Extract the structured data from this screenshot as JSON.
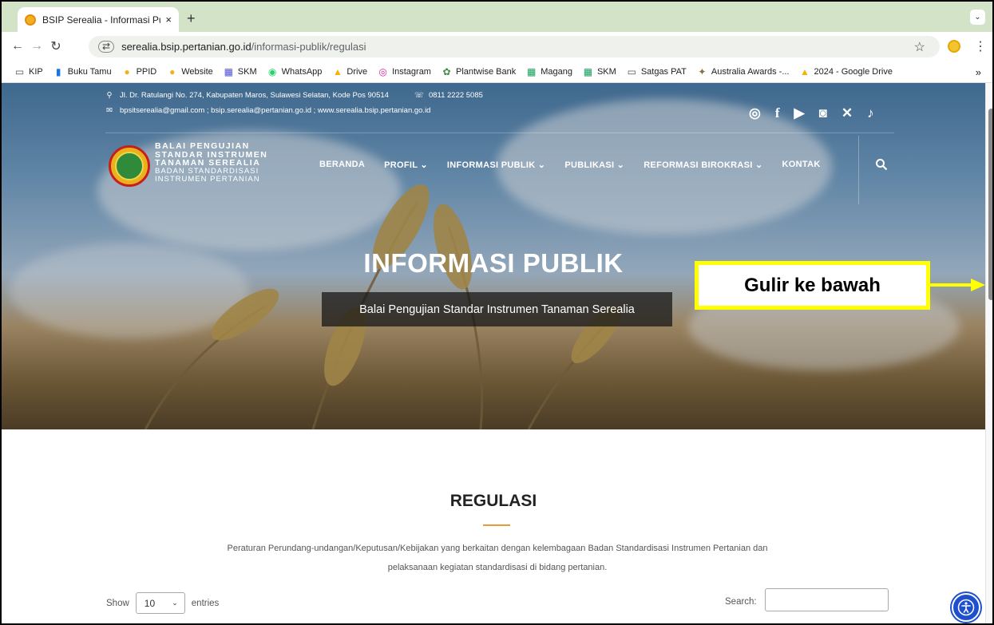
{
  "browser": {
    "tab_title": "BSIP Serealia - Informasi Publ",
    "tab_close": "×",
    "new_tab": "+",
    "url_host": "serealia.bsip.pertanian.go.id",
    "url_path": "/informasi-publik/regulasi",
    "bookmarks": [
      {
        "label": "KIP",
        "icon": "folder-icon",
        "color": "#555555"
      },
      {
        "label": "Buku Tamu",
        "icon": "book-icon",
        "color": "#1a73e8"
      },
      {
        "label": "PPID",
        "icon": "site-icon",
        "color": "#f2b01e"
      },
      {
        "label": "Website",
        "icon": "site-icon",
        "color": "#f2b01e"
      },
      {
        "label": "SKM",
        "icon": "sheets-icon",
        "color": "#4a4fd6"
      },
      {
        "label": "WhatsApp",
        "icon": "whatsapp-icon",
        "color": "#25d366"
      },
      {
        "label": "Drive",
        "icon": "drive-icon",
        "color": "#f4b400"
      },
      {
        "label": "Instagram",
        "icon": "instagram-icon",
        "color": "#d6249f"
      },
      {
        "label": "Plantwise Bank",
        "icon": "plantwise-icon",
        "color": "#3e8e41"
      },
      {
        "label": "Magang",
        "icon": "sheets-icon",
        "color": "#0f9d58"
      },
      {
        "label": "SKM",
        "icon": "sheets-icon",
        "color": "#0f9d58"
      },
      {
        "label": "Satgas PAT",
        "icon": "folder-icon",
        "color": "#555555"
      },
      {
        "label": "Australia Awards -...",
        "icon": "award-icon",
        "color": "#8a6d3b"
      },
      {
        "label": "2024 - Google Drive",
        "icon": "drive-icon",
        "color": "#f4b400"
      }
    ],
    "bookmarks_more": "»"
  },
  "site": {
    "address": "Jl. Dr. Ratulangi No. 274, Kabupaten Maros, Sulawesi Selatan, Kode Pos 90514",
    "phone": "0811 2222 5085",
    "emails": "bpsitserealia@gmail.com ; bsip.serealia@pertanian.go.id ; www.serealia.bsip.pertanian.go.id",
    "brand_lines": [
      "BALAI PENGUJIAN",
      "STANDAR INSTRUMEN",
      "TANAMAN SEREALIA"
    ],
    "brand_sub_lines": [
      "BADAN STANDARDISASI",
      "INSTRUMEN PERTANIAN"
    ],
    "nav": [
      "BERANDA",
      "PROFIL ⌄",
      "INFORMASI PUBLIK ⌄",
      "PUBLIKASI ⌄",
      "REFORMASI BIROKRASI ⌄",
      "KONTAK"
    ],
    "hero_title": "INFORMASI PUBLIK",
    "hero_subtitle": "Balai Pengujian Standar Instrumen Tanaman Serealia"
  },
  "annotation": {
    "text": "Gulir ke bawah",
    "color": "#ffff00"
  },
  "content": {
    "title": "REGULASI",
    "description_line1": "Peraturan Perundang-undangan/Keputusan/Kebijakan yang berkaitan dengan kelembagaan Badan Standardisasi Instrumen Pertanian dan",
    "description_line2": "pelaksanaan kegiatan standardisasi di bidang pertanian.",
    "show_label": "Show",
    "entries_value": "10",
    "entries_label": "entries",
    "search_label": "Search:"
  }
}
